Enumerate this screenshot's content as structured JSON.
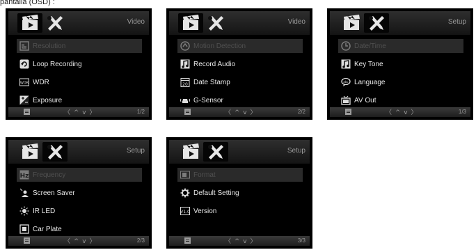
{
  "caption": "pantalla (OSD) :",
  "colors": {
    "background": "#000000",
    "text": "#e8e8e8",
    "muted": "#9a9a9a",
    "selected_row": "#2a2a2a"
  },
  "nav_symbols": "〈 ^ v 〉",
  "screens": [
    {
      "mode": "Video",
      "active_tab": "video",
      "page": "1/2",
      "items": [
        {
          "label": "Resolution",
          "icon": "resolution-icon",
          "selected": true
        },
        {
          "label": "Loop Recording",
          "icon": "loop-recording-icon",
          "selected": false
        },
        {
          "label": "WDR",
          "icon": "wdr-icon",
          "selected": false
        },
        {
          "label": "Exposure",
          "icon": "exposure-icon",
          "selected": false
        }
      ]
    },
    {
      "mode": "Video",
      "active_tab": "video",
      "page": "2/2",
      "items": [
        {
          "label": "Motion Detection",
          "icon": "motion-detection-icon",
          "selected": true
        },
        {
          "label": "Record Audio",
          "icon": "record-audio-icon",
          "selected": false
        },
        {
          "label": "Date Stamp",
          "icon": "date-stamp-icon",
          "selected": false
        },
        {
          "label": "G-Sensor",
          "icon": "g-sensor-icon",
          "selected": false
        }
      ]
    },
    {
      "mode": "Setup",
      "active_tab": "setup",
      "page": "1/3",
      "items": [
        {
          "label": "Date/Time",
          "icon": "clock-icon",
          "selected": true
        },
        {
          "label": "Key Tone",
          "icon": "key-tone-icon",
          "selected": false
        },
        {
          "label": "Language",
          "icon": "language-icon",
          "selected": false
        },
        {
          "label": "AV Out",
          "icon": "tv-icon",
          "selected": false
        }
      ]
    },
    {
      "mode": "Setup",
      "active_tab": "setup",
      "page": "2/3",
      "items": [
        {
          "label": "Frequency",
          "icon": "frequency-icon",
          "selected": true
        },
        {
          "label": "Screen Saver",
          "icon": "screen-saver-icon",
          "selected": false
        },
        {
          "label": "IR LED",
          "icon": "ir-led-icon",
          "selected": false
        },
        {
          "label": "Car Plate",
          "icon": "car-plate-icon",
          "selected": false
        }
      ]
    },
    {
      "mode": "Setup",
      "active_tab": "setup",
      "page": "3/3",
      "items": [
        {
          "label": "Format",
          "icon": "format-icon",
          "selected": true
        },
        {
          "label": "Default Setting",
          "icon": "default-setting-icon",
          "selected": false
        },
        {
          "label": "Version",
          "icon": "version-icon",
          "selected": false
        }
      ]
    }
  ]
}
